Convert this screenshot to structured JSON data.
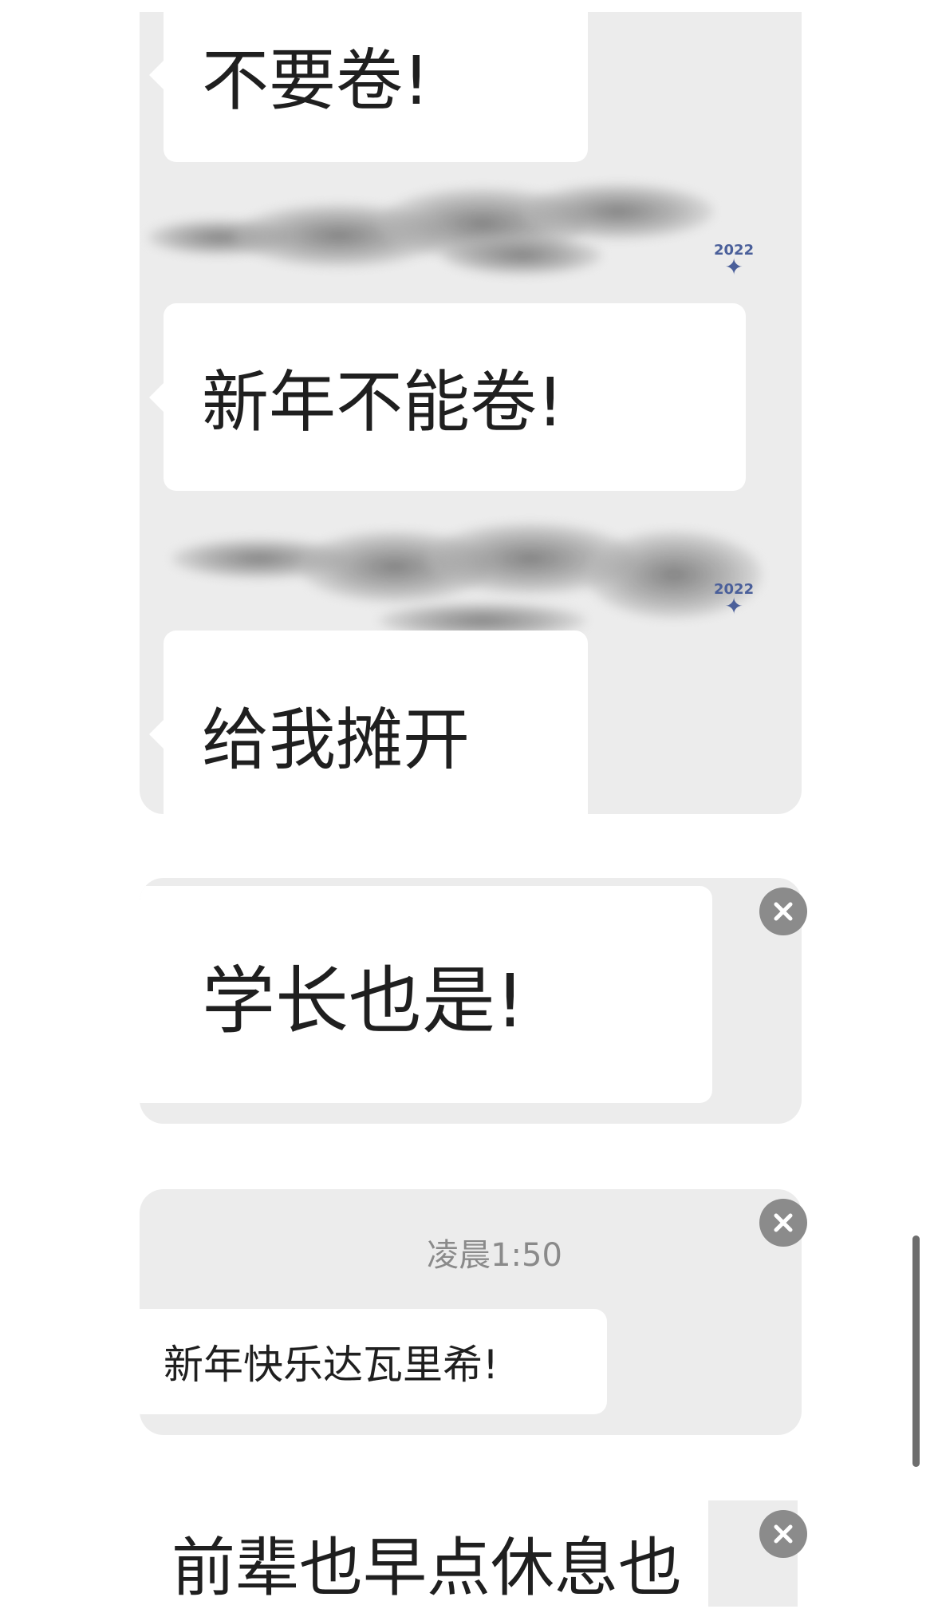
{
  "messages": {
    "m1": "不要卷!",
    "m2": "新年不能卷!",
    "m3": "给我摊开",
    "m4": "学长也是!",
    "m5": "新年快乐达瓦里希!",
    "m6": "前辈也早点休息也"
  },
  "timestamp": "凌晨1:50",
  "logo": {
    "year": "2022"
  },
  "icons": {
    "close": "close-icon",
    "logo": "olympic-logo-icon"
  },
  "colors": {
    "card_bg": "#ececec",
    "bubble_bg": "#ffffff",
    "close_bg": "#8b8b8b",
    "logo": "#4a5f9a"
  }
}
